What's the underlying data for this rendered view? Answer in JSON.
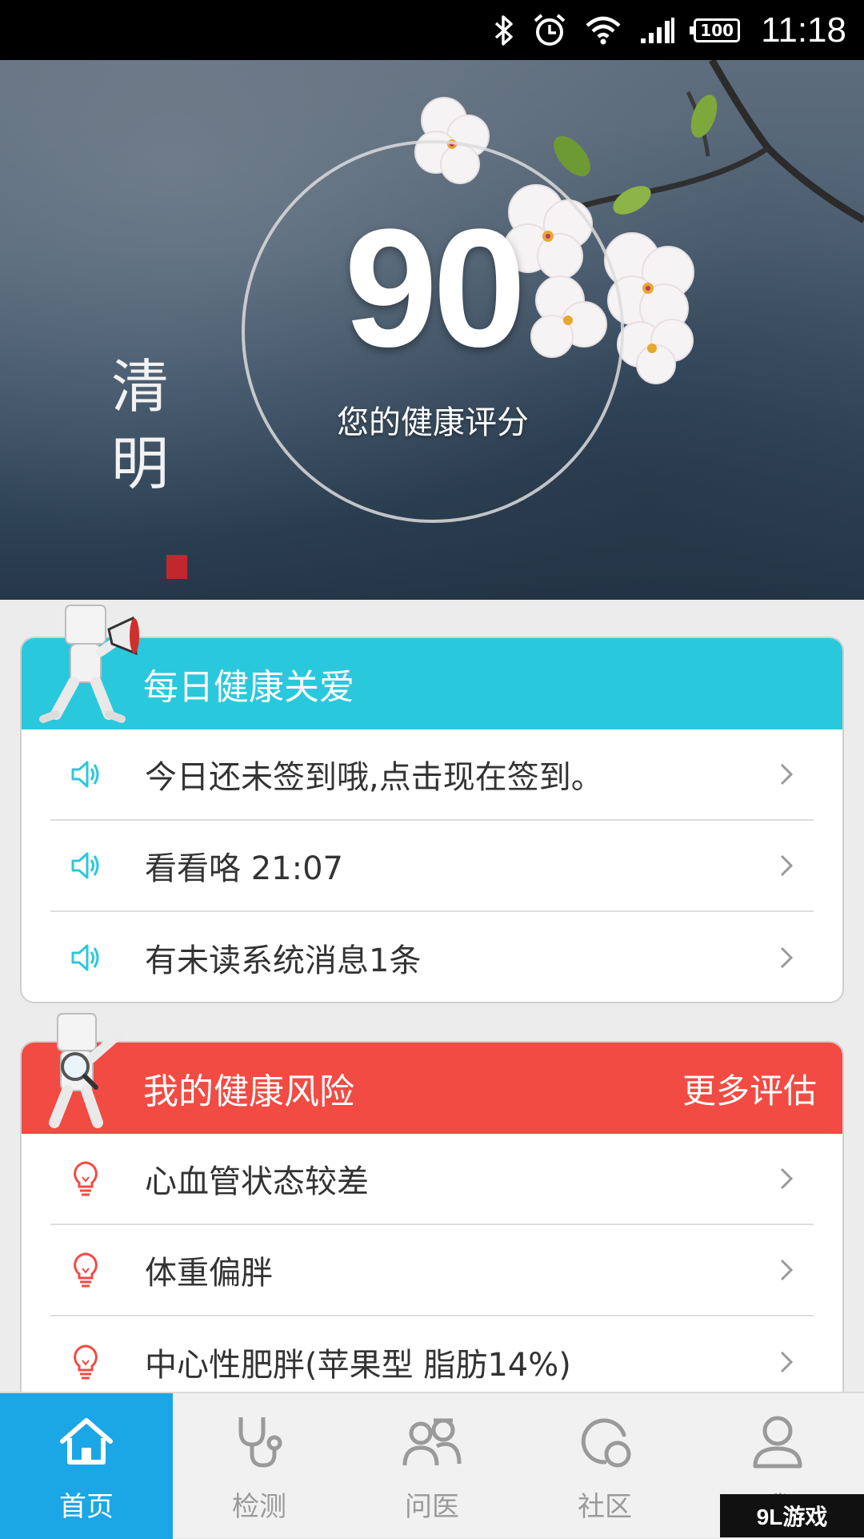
{
  "status_bar": {
    "time": "11:18",
    "battery": "100",
    "icons": [
      "bluetooth-icon",
      "alarm-icon",
      "wifi-icon",
      "signal-icon",
      "battery-icon"
    ]
  },
  "hero": {
    "score": "90",
    "score_label": "您的健康评分",
    "calligraphy": "清明"
  },
  "daily_care": {
    "title": "每日健康关爱",
    "color": "#2ac8dd",
    "items": [
      {
        "text": "今日还未签到哦,点击现在签到。",
        "icon": "speaker-icon"
      },
      {
        "text": "看看咯 21:07",
        "icon": "speaker-icon"
      },
      {
        "text": "有未读系统消息1条",
        "icon": "speaker-icon"
      }
    ]
  },
  "health_risk": {
    "title": "我的健康风险",
    "more": "更多评估",
    "color": "#f24b43",
    "items": [
      {
        "text": "心血管状态较差",
        "icon": "lightbulb-icon"
      },
      {
        "text": "体重偏胖",
        "icon": "lightbulb-icon"
      },
      {
        "text": "中心性肥胖(苹果型 脂肪14%)",
        "icon": "lightbulb-icon"
      }
    ]
  },
  "bottom_nav": {
    "active_color": "#1ba6e6",
    "items": [
      {
        "label": "首页",
        "icon": "home-icon",
        "active": true
      },
      {
        "label": "检测",
        "icon": "stethoscope-icon",
        "active": false
      },
      {
        "label": "问医",
        "icon": "doctors-icon",
        "active": false
      },
      {
        "label": "社区",
        "icon": "community-icon",
        "active": false
      },
      {
        "label": "我",
        "icon": "person-icon",
        "active": false
      }
    ]
  },
  "watermark": "9L游戏"
}
